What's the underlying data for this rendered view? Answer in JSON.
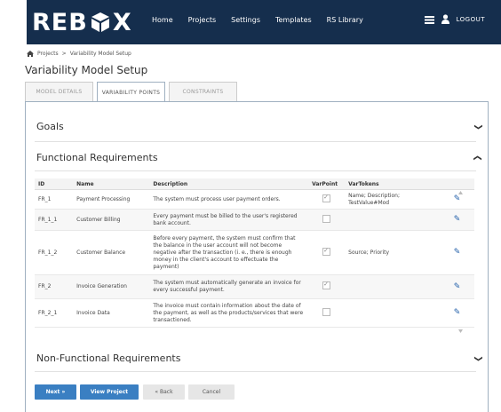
{
  "header": {
    "logo_text_left": "REB",
    "logo_text_right": "X",
    "nav": [
      "Home",
      "Projects",
      "Settings",
      "Templates",
      "RS Library"
    ],
    "logout_label": "LOGOUT"
  },
  "breadcrumb": {
    "root": "Projects",
    "separator": ">",
    "current": "Variability Model Setup"
  },
  "page_title": "Variability Model Setup",
  "tabs": [
    {
      "label": "MODEL DETAILS",
      "active": false
    },
    {
      "label": "VARIABILITY POINTS",
      "active": true
    },
    {
      "label": "CONSTRAINTS",
      "active": false
    }
  ],
  "sections": {
    "goals": "Goals",
    "functional": "Functional Requirements",
    "non_functional": "Non-Functional Requirements"
  },
  "table": {
    "columns": [
      "ID",
      "Name",
      "Description",
      "VarPoint",
      "VarTokens"
    ],
    "rows": [
      {
        "id": "FR_1",
        "name": "Payment Processing",
        "description": "The system must process user payment orders.",
        "varpoint": true,
        "vartokens": "Name; Description; TestValue#Mod"
      },
      {
        "id": "FR_1_1",
        "name": "Customer Billing",
        "description": "Every payment must be billed to the user's registered bank account.",
        "varpoint": false,
        "vartokens": ""
      },
      {
        "id": "FR_1_2",
        "name": "Customer Balance",
        "description": "Before every payment, the system must confirm that the balance in the user account will not become negative after the transaction (i. e., there is enough money in the client's account to effectuate the payment)",
        "varpoint": true,
        "vartokens": "Source; Priority"
      },
      {
        "id": "FR_2",
        "name": "Invoice Generation",
        "description": "The system must automatically generate an invoice for every successful payment.",
        "varpoint": true,
        "vartokens": ""
      },
      {
        "id": "FR_2_1",
        "name": "Invoice Data",
        "description": "The invoice must contain information about the date of the payment, as well as the products/services that were transactioned.",
        "varpoint": false,
        "vartokens": ""
      }
    ]
  },
  "buttons": {
    "next": "Next »",
    "view_project": "View Project",
    "back": "« Back",
    "cancel": "Cancel"
  },
  "colors": {
    "navbar": "#152e4d",
    "primary": "#3a7fc2",
    "pencil": "#1f5da8"
  }
}
